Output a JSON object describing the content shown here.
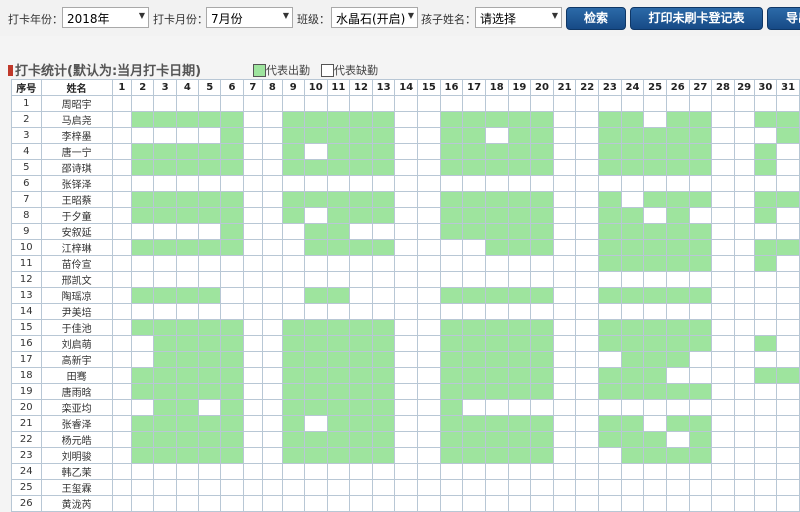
{
  "filters": {
    "year_label": "打卡年份：",
    "year_value": "2018年",
    "month_label": "打卡月份：",
    "month_value": "7月份",
    "class_label": "班级：",
    "class_value": "水晶石(开启)",
    "child_label": "孩子姓名：",
    "child_value": "请选择"
  },
  "buttons": {
    "search": "检索",
    "print": "打印未刷卡登记表",
    "export": "导出"
  },
  "section": {
    "title": "打卡统计(默认为:当月打卡日期)"
  },
  "legend": {
    "present": "代表出勤",
    "absent": "代表缺勤"
  },
  "colors": {
    "present": "#9ee49e",
    "absent": "#ffffff",
    "button": "#1f5a96",
    "title_bar": "#c0392b"
  },
  "table": {
    "headers": {
      "index": "序号",
      "name": "姓名"
    },
    "days": [
      "1",
      "2",
      "3",
      "4",
      "5",
      "6",
      "7",
      "8",
      "9",
      "10",
      "11",
      "12",
      "13",
      "14",
      "15",
      "16",
      "17",
      "18",
      "19",
      "20",
      "21",
      "22",
      "23",
      "24",
      "25",
      "26",
      "27",
      "28",
      "29",
      "30",
      "31"
    ],
    "rows": [
      {
        "no": "1",
        "name": "周昭宇",
        "present": []
      },
      {
        "no": "2",
        "name": "马启尧",
        "present": [
          2,
          3,
          4,
          5,
          6,
          9,
          10,
          11,
          12,
          13,
          16,
          17,
          18,
          19,
          20,
          23,
          24,
          26,
          27,
          30,
          31
        ]
      },
      {
        "no": "3",
        "name": "李梓墨",
        "present": [
          6,
          9,
          10,
          11,
          12,
          13,
          16,
          17,
          19,
          20,
          23,
          24,
          25,
          26,
          27,
          31
        ]
      },
      {
        "no": "4",
        "name": "唐一宁",
        "present": [
          2,
          3,
          4,
          5,
          6,
          9,
          11,
          12,
          13,
          16,
          17,
          18,
          19,
          20,
          23,
          24,
          25,
          26,
          27,
          30
        ]
      },
      {
        "no": "5",
        "name": "邵诗琪",
        "present": [
          2,
          3,
          4,
          5,
          6,
          9,
          10,
          11,
          12,
          13,
          16,
          17,
          18,
          19,
          20,
          23,
          24,
          25,
          26,
          27,
          30
        ]
      },
      {
        "no": "6",
        "name": "张铎泽",
        "present": []
      },
      {
        "no": "7",
        "name": "王昭蔡",
        "present": [
          2,
          3,
          4,
          5,
          6,
          9,
          10,
          11,
          12,
          13,
          16,
          17,
          18,
          19,
          20,
          23,
          25,
          26,
          27,
          30,
          31
        ]
      },
      {
        "no": "8",
        "name": "于夕童",
        "present": [
          2,
          3,
          4,
          5,
          6,
          9,
          11,
          12,
          13,
          16,
          17,
          18,
          19,
          20,
          23,
          24,
          26,
          30
        ]
      },
      {
        "no": "9",
        "name": "安叙延",
        "present": [
          6,
          10,
          11,
          16,
          17,
          18,
          19,
          20,
          23,
          24,
          25,
          26,
          27
        ]
      },
      {
        "no": "10",
        "name": "江梓琳",
        "present": [
          2,
          3,
          4,
          5,
          6,
          10,
          11,
          12,
          13,
          18,
          19,
          20,
          23,
          24,
          25,
          26,
          27,
          30,
          31
        ]
      },
      {
        "no": "11",
        "name": "苗伶宣",
        "present": [
          23,
          24,
          25,
          26,
          27,
          30
        ]
      },
      {
        "no": "12",
        "name": "邢凯文",
        "present": []
      },
      {
        "no": "13",
        "name": "陶瑶凉",
        "present": [
          2,
          3,
          4,
          5,
          10,
          11,
          16,
          17,
          18,
          19,
          20,
          23,
          24,
          25,
          26,
          27
        ]
      },
      {
        "no": "14",
        "name": "尹美培",
        "present": []
      },
      {
        "no": "15",
        "name": "于佳池",
        "present": [
          2,
          3,
          4,
          5,
          6,
          9,
          10,
          11,
          12,
          13,
          16,
          17,
          18,
          19,
          20,
          23,
          24,
          25,
          26,
          27
        ]
      },
      {
        "no": "16",
        "name": "刘启萌",
        "present": [
          3,
          4,
          5,
          6,
          9,
          10,
          11,
          12,
          13,
          16,
          17,
          18,
          19,
          20,
          23,
          24,
          25,
          26,
          27,
          30
        ]
      },
      {
        "no": "17",
        "name": "高新宇",
        "present": [
          3,
          4,
          5,
          6,
          9,
          10,
          11,
          12,
          13,
          16,
          17,
          18,
          19,
          20,
          24,
          25,
          26
        ]
      },
      {
        "no": "18",
        "name": "田骞",
        "present": [
          2,
          3,
          4,
          5,
          6,
          9,
          10,
          11,
          12,
          13,
          16,
          17,
          18,
          19,
          20,
          23,
          24,
          25,
          30,
          31
        ]
      },
      {
        "no": "19",
        "name": "唐雨晗",
        "present": [
          2,
          3,
          4,
          5,
          6,
          9,
          10,
          11,
          12,
          13,
          16,
          17,
          18,
          19,
          20,
          23,
          24,
          25,
          26,
          27
        ]
      },
      {
        "no": "20",
        "name": "栾亚均",
        "present": [
          3,
          4,
          6,
          9,
          10,
          11,
          12,
          13,
          16
        ]
      },
      {
        "no": "21",
        "name": "张睿泽",
        "present": [
          2,
          3,
          4,
          5,
          6,
          9,
          11,
          12,
          13,
          16,
          17,
          18,
          19,
          20,
          23,
          24,
          26,
          27
        ]
      },
      {
        "no": "22",
        "name": "杨元皓",
        "present": [
          2,
          3,
          4,
          5,
          6,
          9,
          10,
          11,
          12,
          13,
          16,
          17,
          18,
          19,
          20,
          23,
          24,
          25,
          27
        ]
      },
      {
        "no": "23",
        "name": "刘明骏",
        "present": [
          2,
          3,
          4,
          5,
          6,
          9,
          10,
          11,
          12,
          13,
          16,
          17,
          18,
          19,
          20,
          24,
          25,
          26,
          27
        ]
      },
      {
        "no": "24",
        "name": "韩乙茉",
        "present": []
      },
      {
        "no": "25",
        "name": "王玺霖",
        "present": []
      },
      {
        "no": "26",
        "name": "黄泷芮",
        "present": []
      }
    ]
  }
}
